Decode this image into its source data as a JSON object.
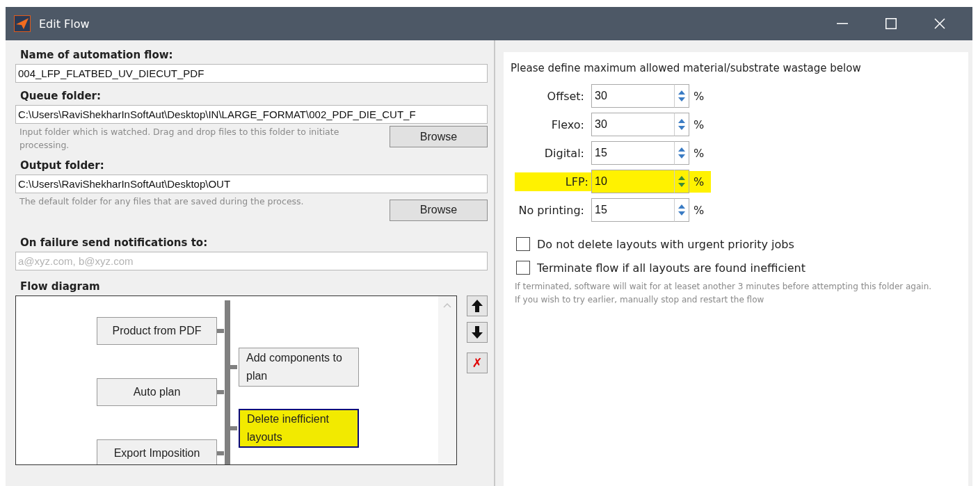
{
  "window": {
    "title": "Edit Flow"
  },
  "fields": [
    {
      "label": "Name of automation flow:",
      "value": "004_LFP_FLATBED_UV_DIECUT_PDF"
    },
    {
      "label": "Queue folder:",
      "value": "C:\\Users\\RaviShekharInSoftAut\\Desktop\\IN\\LARGE_FORMAT\\002_PDF_DIE_CUT_F",
      "hint": "Input folder which is watched. Drag and drop files to this folder to initiate processing.",
      "button": "Browse"
    },
    {
      "label": "Output folder:",
      "value": "C:\\Users\\RaviShekharInSoftAut\\Desktop\\OUT",
      "hint": "The default folder for any files that are saved during the process.",
      "button": "Browse"
    },
    {
      "label": "On failure send notifications to:",
      "placeholder": "a@xyz.com, b@xyz.com"
    }
  ],
  "flow_diagram": {
    "title": "Flow diagram",
    "nodes": [
      {
        "label": "Product from PDF",
        "selected": false
      },
      {
        "label": "Add components to plan",
        "selected": false
      },
      {
        "label": "Auto plan",
        "selected": false
      },
      {
        "label": "Delete inefficient layouts",
        "selected": true
      },
      {
        "label": "Export Imposition",
        "selected": false
      }
    ],
    "delete_label": "✗"
  },
  "wastage": {
    "intro": "Please define maximum allowed material/substrate wastage below",
    "rows": [
      {
        "label": "Offset:",
        "value": "30",
        "unit": "%",
        "highlighted": false
      },
      {
        "label": "Flexo:",
        "value": "30",
        "unit": "%",
        "highlighted": false
      },
      {
        "label": "Digital:",
        "value": "15",
        "unit": "%",
        "highlighted": false
      },
      {
        "label": "LFP:",
        "value": "10",
        "unit": "%",
        "highlighted": true
      },
      {
        "label": "No printing:",
        "value": "15",
        "unit": "%",
        "highlighted": false
      }
    ],
    "options": [
      {
        "label": "Do not delete layouts with urgent priority jobs",
        "checked": false
      },
      {
        "label": "Terminate flow if all layouts are found inefficient",
        "checked": false
      }
    ],
    "note": "If terminated, software will wait for at leaset another 3 minutes before attempting this folder again. If you wish to try earlier, manually stop and restart the flow"
  }
}
